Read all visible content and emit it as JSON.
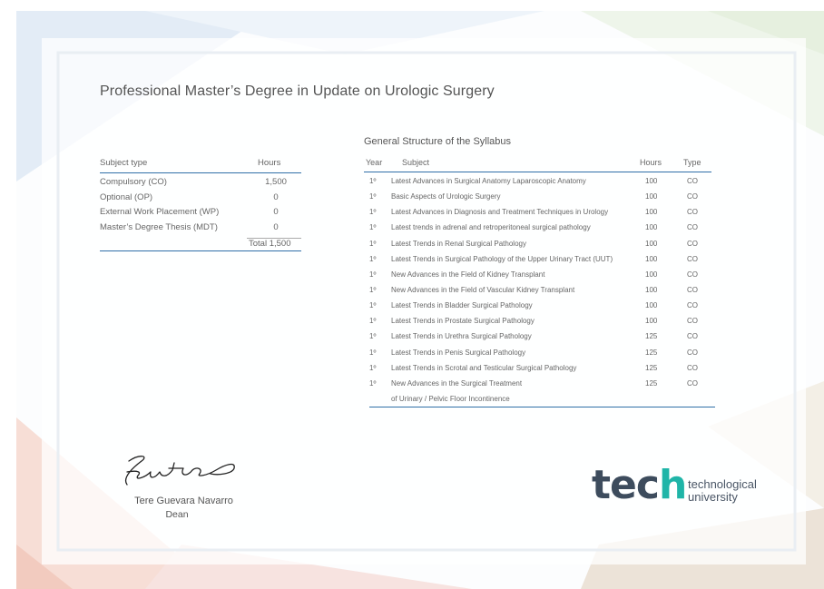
{
  "certificate": {
    "title": "Professional Master’s Degree in Update on Urologic Surgery"
  },
  "summary": {
    "header": {
      "subject_type": "Subject type",
      "hours": "Hours"
    },
    "rows": [
      {
        "label": "Compulsory (CO)",
        "hours": "1,500"
      },
      {
        "label": "Optional (OP)",
        "hours": "0"
      },
      {
        "label": "External Work Placement (WP)",
        "hours": "0"
      },
      {
        "label": "Master’s Degree Thesis (MDT)",
        "hours": "0"
      }
    ],
    "total": "Total 1,500"
  },
  "syllabus": {
    "title": "General Structure of the Syllabus",
    "header": {
      "year": "Year",
      "subject": "Subject",
      "hours": "Hours",
      "type": "Type"
    },
    "rows": [
      {
        "year": "1º",
        "subject": "Latest Advances in Surgical Anatomy Laparoscopic Anatomy",
        "hours": "100",
        "type": "CO"
      },
      {
        "year": "1º",
        "subject": "Basic Aspects of Urologic Surgery",
        "hours": "100",
        "type": "CO"
      },
      {
        "year": "1º",
        "subject": "Latest Advances in Diagnosis and Treatment Techniques in Urology",
        "hours": "100",
        "type": "CO"
      },
      {
        "year": "1º",
        "subject": "Latest trends in adrenal and retroperitoneal surgical pathology",
        "hours": "100",
        "type": "CO"
      },
      {
        "year": "1º",
        "subject": "Latest Trends in Renal Surgical Pathology",
        "hours": "100",
        "type": "CO"
      },
      {
        "year": "1º",
        "subject": "Latest Trends in Surgical Pathology of the Upper Urinary Tract (UUT)",
        "hours": "100",
        "type": "CO"
      },
      {
        "year": "1º",
        "subject": "New Advances in the Field of Kidney Transplant",
        "hours": "100",
        "type": "CO"
      },
      {
        "year": "1º",
        "subject": "New Advances in the Field of Vascular Kidney Transplant",
        "hours": "100",
        "type": "CO"
      },
      {
        "year": "1º",
        "subject": "Latest Trends in Bladder Surgical Pathology",
        "hours": "100",
        "type": "CO"
      },
      {
        "year": "1º",
        "subject": "Latest Trends in Prostate Surgical Pathology",
        "hours": "100",
        "type": "CO"
      },
      {
        "year": "1º",
        "subject": "Latest Trends in Urethra Surgical Pathology",
        "hours": "125",
        "type": "CO"
      },
      {
        "year": "1º",
        "subject": "Latest Trends in Penis Surgical Pathology",
        "hours": "125",
        "type": "CO"
      },
      {
        "year": "1º",
        "subject": "Latest Trends in Scrotal and Testicular Surgical Pathology",
        "hours": "125",
        "type": "CO"
      },
      {
        "year": "1º",
        "subject": "New Advances in the Surgical Treatment",
        "hours": "125",
        "type": "CO"
      },
      {
        "year": "",
        "subject": "of Urinary / Pelvic Floor Incontinence",
        "hours": "",
        "type": ""
      }
    ]
  },
  "signatory": {
    "name": "Tere Guevara Navarro",
    "role": "Dean"
  },
  "logo": {
    "word": "tec",
    "accent_letter": "h",
    "line1": "technological",
    "line2": "university",
    "accent_color": "#1fb5a8",
    "text_color": "#3d4c5d"
  },
  "colors": {
    "rule": "#2f6fa8"
  }
}
